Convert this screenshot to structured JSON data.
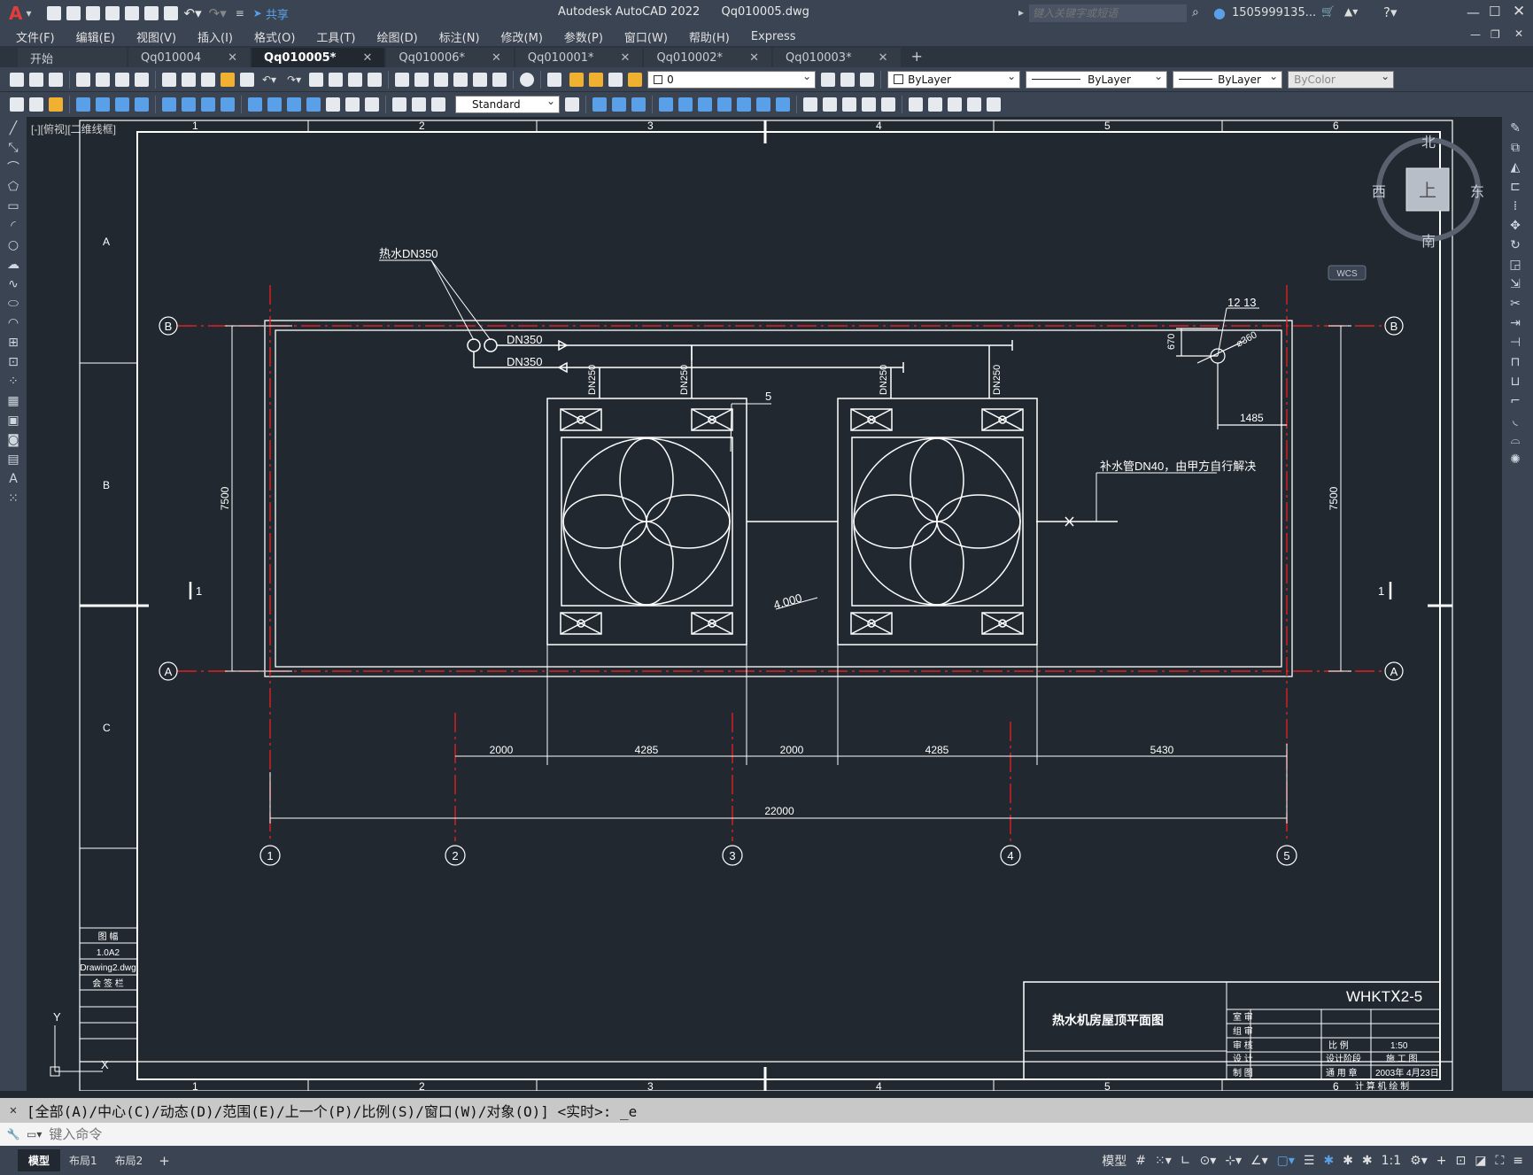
{
  "app": {
    "title": "Autodesk AutoCAD 2022",
    "filename": "Qq010005.dwg",
    "share_label": "共享",
    "search_placeholder": "键入关键字或短语",
    "user": "1505999135...",
    "logo": "A"
  },
  "menu": [
    "文件(F)",
    "编辑(E)",
    "视图(V)",
    "插入(I)",
    "格式(O)",
    "工具(T)",
    "绘图(D)",
    "标注(N)",
    "修改(M)",
    "参数(P)",
    "窗口(W)",
    "帮助(H)",
    "Express"
  ],
  "tabs": [
    {
      "label": "开始",
      "active": false,
      "closable": false
    },
    {
      "label": "Qq010004",
      "active": false,
      "closable": true
    },
    {
      "label": "Qq010005*",
      "active": true,
      "closable": true
    },
    {
      "label": "Qq010006*",
      "active": false,
      "closable": true
    },
    {
      "label": "Qq010001*",
      "active": false,
      "closable": true
    },
    {
      "label": "Qq010002*",
      "active": false,
      "closable": true
    },
    {
      "label": "Qq010003*",
      "active": false,
      "closable": true
    }
  ],
  "toolbar": {
    "layer_value": "0",
    "color_value": "ByLayer",
    "linetype_value": "ByLayer",
    "lineweight_value": "ByLayer",
    "plotstyle_value": "ByColor",
    "textstyle_value": "Standard"
  },
  "viewport_label": "[-][俯视][二维线框]",
  "viewcube": {
    "north": "北",
    "south": "南",
    "east": "东",
    "west": "西",
    "top": "上",
    "wcs": "WCS"
  },
  "drawing": {
    "border_cols": [
      "1",
      "2",
      "3",
      "4",
      "5",
      "6"
    ],
    "border_rows": [
      "A",
      "B",
      "C"
    ],
    "grid_axes_h": [
      "1",
      "2",
      "3",
      "4",
      "5"
    ],
    "grid_axes_v": [
      "A",
      "B"
    ],
    "label_pipe_top": "热水DN350",
    "pipe1": "DN350",
    "pipe2": "DN350",
    "branch_pipes": [
      "DN250",
      "DN250",
      "DN250",
      "DN250"
    ],
    "item5": "5",
    "item1213": "12 13",
    "dim670": "670",
    "dia360": "⌀360",
    "dim1485": "1485",
    "makeup_label": "补水管DN40，由甲方自行解决",
    "elev": "4.000",
    "section_mark": "1",
    "dim7500": "7500",
    "dims_row": [
      "2000",
      "4285",
      "2000",
      "4285",
      "5430"
    ],
    "dim_total": "22000",
    "title_name": "热水机房屋顶平面图",
    "drawing_no": "WHKTⅩ2-5",
    "left_table": [
      "图 幅",
      "1.0A2",
      "Drawing2.dwg",
      "会 签 栏"
    ],
    "tb_roles": [
      "室 审",
      "组 审",
      "审 核",
      "设 计",
      "制 图"
    ],
    "tb_scale_label": "比 例",
    "tb_scale": "1:50",
    "tb_stage_label": "设计阶段",
    "tb_stage": "施 工 图",
    "tb_date_label": "通 用 章",
    "tb_date": "2003年 4月23日",
    "tb_footer": "计 算 机 绘 制",
    "ucs_y": "Y",
    "ucs_x": "X"
  },
  "command": {
    "history": "[全部(A)/中心(C)/动态(D)/范围(E)/上一个(P)/比例(S)/窗口(W)/对象(O)] <实时>: _e",
    "placeholder": "键入命令"
  },
  "layout_tabs": [
    "模型",
    "布局1",
    "布局2"
  ],
  "status": {
    "model": "模型",
    "scale": "1:1"
  }
}
